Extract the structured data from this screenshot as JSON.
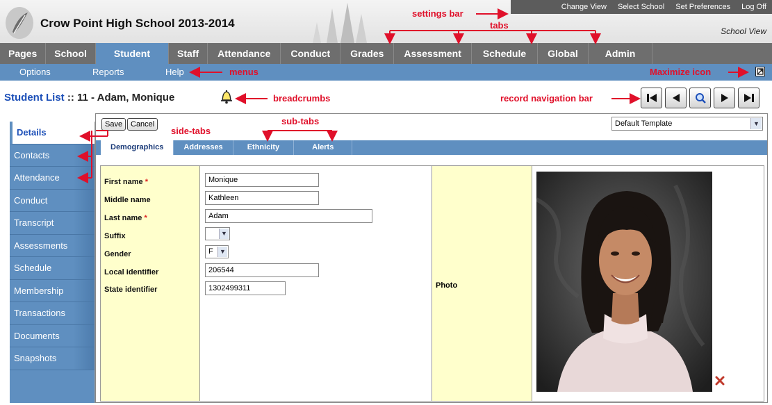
{
  "header": {
    "school_title": "Crow Point High School 2013-2014",
    "school_view": "School View"
  },
  "settings_bar": {
    "items": [
      "Change View",
      "Select School",
      "Set Preferences",
      "Log Off"
    ]
  },
  "tabs": {
    "items": [
      "Pages",
      "School",
      "Student",
      "Staff",
      "Attendance",
      "Conduct",
      "Grades",
      "Assessment",
      "Schedule",
      "Global",
      "Admin"
    ],
    "active": "Student"
  },
  "menus": {
    "items": [
      "Options",
      "Reports",
      "Help"
    ]
  },
  "breadcrumb": {
    "link": "Student List",
    "separator": " :: ",
    "record": "11 - Adam, Monique"
  },
  "side_tabs": {
    "items": [
      "Details",
      "Contacts",
      "Attendance",
      "Conduct",
      "Transcript",
      "Assessments",
      "Schedule",
      "Membership",
      "Transactions",
      "Documents",
      "Snapshots"
    ],
    "active": "Details"
  },
  "toolbar": {
    "save_label": "Save",
    "cancel_label": "Cancel",
    "template_value": "Default Template"
  },
  "sub_tabs": {
    "items": [
      "Demographics",
      "Addresses",
      "Ethnicity",
      "Alerts"
    ],
    "active": "Demographics"
  },
  "form": {
    "first_name_label": "First name",
    "first_name_value": "Monique",
    "middle_name_label": "Middle name",
    "middle_name_value": "Kathleen",
    "last_name_label": "Last name",
    "last_name_value": "Adam",
    "suffix_label": "Suffix",
    "suffix_value": "",
    "gender_label": "Gender",
    "gender_value": "F",
    "local_id_label": "Local identifier",
    "local_id_value": "206544",
    "state_id_label": "State identifier",
    "state_id_value": "1302499311",
    "required_marker": "*",
    "photo_label": "Photo"
  },
  "annotations": {
    "settings_bar": "settings bar",
    "tabs": "tabs",
    "menus": "menus",
    "maximize_icon": "Maximize icon",
    "breadcrumbs": "breadcrumbs",
    "record_navigation_bar": "record navigation bar",
    "side_tabs": "side-tabs",
    "sub_tabs": "sub-tabs"
  },
  "colors": {
    "accent_blue": "#5f8fc0",
    "tab_gray": "#6e6e6e",
    "label_yellow": "#ffffcc",
    "annotation_red": "#e0102a",
    "link_blue": "#1c4fb8"
  },
  "icons": {
    "logo": "school-logo-icon",
    "maximize": "maximize-icon",
    "bell": "bell-icon",
    "first": "first-record-icon",
    "prev": "previous-record-icon",
    "search": "search-icon",
    "next": "next-record-icon",
    "last": "last-record-icon",
    "delete": "delete-photo-icon"
  }
}
